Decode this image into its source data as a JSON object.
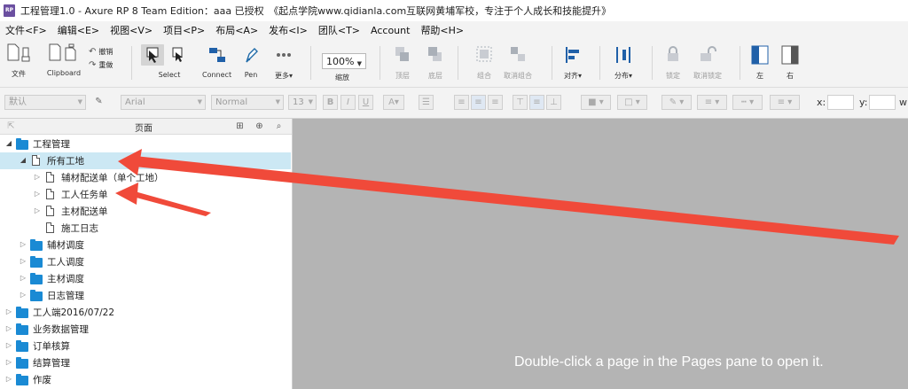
{
  "window": {
    "logo_text": "RP",
    "title": "工程管理1.0 - Axure RP 8 Team Edition：aaa 已授权　《起点学院www.qidianla.com互联网黄埔军校，专注于个人成长和技能提升》"
  },
  "menu": [
    "文件<F>",
    "编辑<E>",
    "视图<V>",
    "项目<P>",
    "布局<A>",
    "发布<I>",
    "团队<T>",
    "Account",
    "帮助<H>"
  ],
  "toolbar": {
    "file": "文件",
    "clipboard": "Clipboard",
    "undo": "撤销",
    "redo": "重做",
    "select": "Select",
    "connect": "Connect",
    "pen": "Pen",
    "more": "更多▾",
    "zoom_value": "100%",
    "zoom_label": "缩放",
    "top": "顶层",
    "bottom": "底层",
    "group": "组合",
    "ungroup": "取消组合",
    "align": "对齐▾",
    "distribute": "分布▾",
    "lock": "锁定",
    "unlock": "取消锁定",
    "left": "左",
    "right": "右"
  },
  "format": {
    "style": "默认",
    "font": "Arial",
    "weight": "Normal",
    "size": "13",
    "bold": "B",
    "italic": "I",
    "underline": "U",
    "x_label": "x:",
    "y_label": "y:",
    "w_label": "w"
  },
  "pages_pane": {
    "title": "页面",
    "tree": [
      {
        "label": "工程管理",
        "type": "folder",
        "level": 0,
        "expanded": true
      },
      {
        "label": "所有工地",
        "type": "page",
        "level": 1,
        "expanded": true,
        "selected": true
      },
      {
        "label": "辅材配送单（单个工地）",
        "type": "page",
        "level": 2,
        "expanded": false
      },
      {
        "label": "工人任务单",
        "type": "page",
        "level": 2,
        "expanded": false
      },
      {
        "label": "主材配送单",
        "type": "page",
        "level": 2,
        "expanded": false
      },
      {
        "label": "施工日志",
        "type": "page",
        "level": 2,
        "leaf": true
      },
      {
        "label": "辅材调度",
        "type": "folder",
        "level": 1,
        "expanded": false
      },
      {
        "label": "工人调度",
        "type": "folder",
        "level": 1,
        "expanded": false
      },
      {
        "label": "主材调度",
        "type": "folder",
        "level": 1,
        "expanded": false
      },
      {
        "label": "日志管理",
        "type": "folder",
        "level": 1,
        "expanded": false
      },
      {
        "label": "工人端2016/07/22",
        "type": "folder",
        "level": 0,
        "expanded": false
      },
      {
        "label": "业务数据管理",
        "type": "folder",
        "level": 0,
        "expanded": false
      },
      {
        "label": "订单核算",
        "type": "folder",
        "level": 0,
        "expanded": false
      },
      {
        "label": "结算管理",
        "type": "folder",
        "level": 0,
        "expanded": false
      },
      {
        "label": "作废",
        "type": "folder",
        "level": 0,
        "expanded": false
      }
    ]
  },
  "canvas": {
    "hint": "Double-click a page in the Pages pane to open it."
  },
  "colors": {
    "annotation_arrow": "#f04a3a",
    "folder": "#1a8ad4",
    "selection": "#cce8f4",
    "canvas": "#b4b4b4"
  }
}
